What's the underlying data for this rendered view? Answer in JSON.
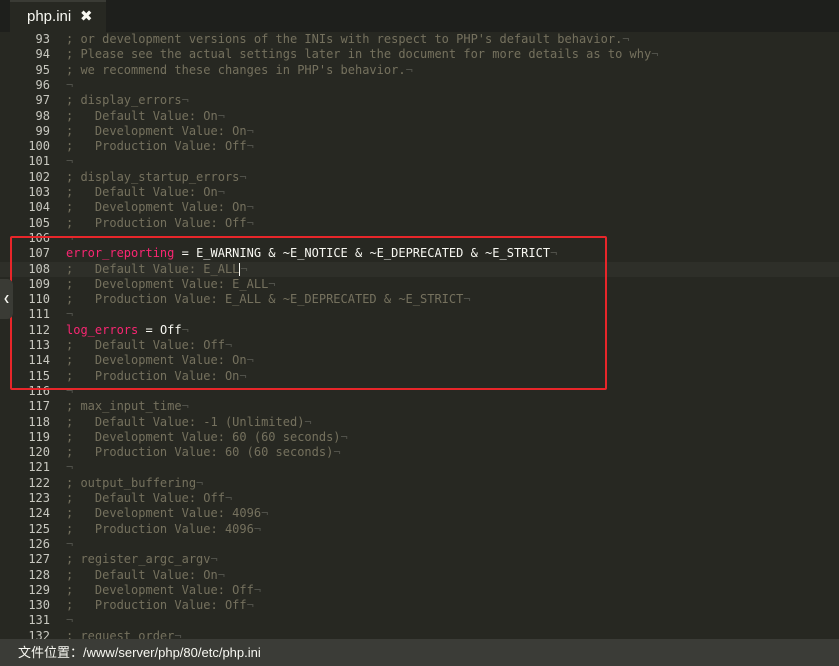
{
  "tab": {
    "title": "php.ini",
    "close_glyph": "✖"
  },
  "editor": {
    "lines": [
      {
        "n": "93",
        "text": "; or development versions of the INIs with respect to PHP's default behavior."
      },
      {
        "n": "94",
        "text": "; Please see the actual settings later in the document for more details as to why"
      },
      {
        "n": "95",
        "text": "; we recommend these changes in PHP's behavior."
      },
      {
        "n": "96",
        "text": ""
      },
      {
        "n": "97",
        "text": "; display_errors"
      },
      {
        "n": "98",
        "text": ";   Default Value: On"
      },
      {
        "n": "99",
        "text": ";   Development Value: On"
      },
      {
        "n": "100",
        "text": ";   Production Value: Off"
      },
      {
        "n": "101",
        "text": ""
      },
      {
        "n": "102",
        "text": "; display_startup_errors"
      },
      {
        "n": "103",
        "text": ";   Default Value: On"
      },
      {
        "n": "104",
        "text": ";   Development Value: On"
      },
      {
        "n": "105",
        "text": ";   Production Value: Off"
      },
      {
        "n": "106",
        "text": ""
      },
      {
        "n": "107",
        "key": "error_reporting",
        "value": "E_WARNING & ~E_NOTICE & ~E_DEPRECATED & ~E_STRICT"
      },
      {
        "n": "108",
        "text": ";   Default Value: E_ALL",
        "active": true
      },
      {
        "n": "109",
        "text": ";   Development Value: E_ALL"
      },
      {
        "n": "110",
        "text": ";   Production Value: E_ALL & ~E_DEPRECATED & ~E_STRICT"
      },
      {
        "n": "111",
        "text": ""
      },
      {
        "n": "112",
        "key": "log_errors",
        "value": "Off"
      },
      {
        "n": "113",
        "text": ";   Default Value: Off"
      },
      {
        "n": "114",
        "text": ";   Development Value: On"
      },
      {
        "n": "115",
        "text": ";   Production Value: On"
      },
      {
        "n": "116",
        "text": ""
      },
      {
        "n": "117",
        "text": "; max_input_time"
      },
      {
        "n": "118",
        "text": ";   Default Value: -1 (Unlimited)"
      },
      {
        "n": "119",
        "text": ";   Development Value: 60 (60 seconds)"
      },
      {
        "n": "120",
        "text": ";   Production Value: 60 (60 seconds)"
      },
      {
        "n": "121",
        "text": ""
      },
      {
        "n": "122",
        "text": "; output_buffering"
      },
      {
        "n": "123",
        "text": ";   Default Value: Off"
      },
      {
        "n": "124",
        "text": ";   Development Value: 4096"
      },
      {
        "n": "125",
        "text": ";   Production Value: 4096"
      },
      {
        "n": "126",
        "text": ""
      },
      {
        "n": "127",
        "text": "; register_argc_argv"
      },
      {
        "n": "128",
        "text": ";   Default Value: On"
      },
      {
        "n": "129",
        "text": ";   Development Value: Off"
      },
      {
        "n": "130",
        "text": ";   Production Value: Off"
      },
      {
        "n": "131",
        "text": ""
      },
      {
        "n": "132",
        "text": "; request_order"
      }
    ]
  },
  "status": {
    "path_label": "文件位置：/www/server/php/80/etc/php.ini"
  },
  "colors": {
    "background": "#272822",
    "comment": "#75715e",
    "keyword": "#f92672",
    "value": "#f8f8f2",
    "highlight_border": "#e8262a"
  }
}
